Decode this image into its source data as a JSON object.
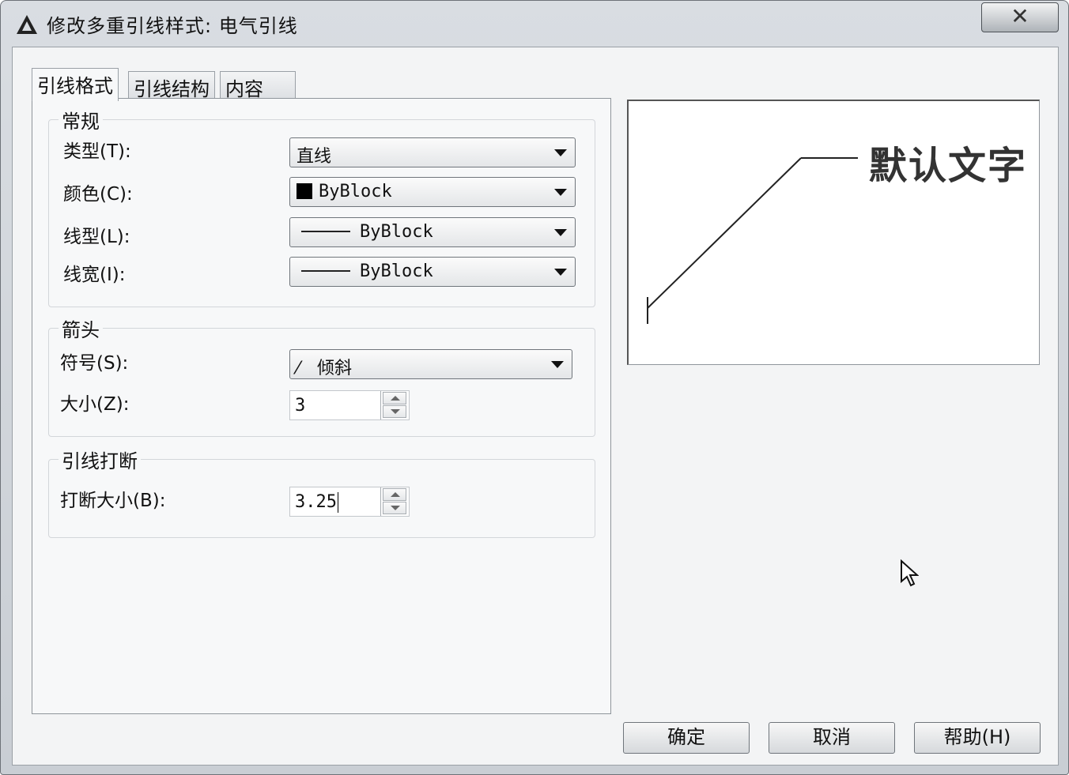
{
  "window": {
    "title": "修改多重引线样式: 电气引线"
  },
  "tabs": [
    {
      "label": "引线格式",
      "active": true
    },
    {
      "label": "引线结构",
      "active": false
    },
    {
      "label": "内容",
      "active": false
    }
  ],
  "general": {
    "title": "常规",
    "type_label": "类型(T):",
    "type_value": "直线",
    "color_label": "颜色(C):",
    "color_value": "ByBlock",
    "linetype_label": "线型(L):",
    "linetype_value": "ByBlock",
    "lineweight_label": "线宽(I):",
    "lineweight_value": "ByBlock"
  },
  "arrowhead": {
    "title": "箭头",
    "symbol_label": "符号(S):",
    "symbol_value": "倾斜",
    "size_label": "大小(Z):",
    "size_value": "3"
  },
  "leader_break": {
    "title": "引线打断",
    "break_size_label": "打断大小(B):",
    "break_size_value": "3.25"
  },
  "preview": {
    "text": "默认文字"
  },
  "buttons": {
    "ok": "确定",
    "cancel": "取消",
    "help": "帮助(H)"
  },
  "colors": {
    "color_swatch": "#000000",
    "dialog_bg": "#f3f4f5"
  },
  "icons": {
    "app": "autocad-logo-icon",
    "close": "close-icon",
    "dropdown": "dropdown-arrow-icon",
    "cursor": "mouse-pointer-icon"
  }
}
